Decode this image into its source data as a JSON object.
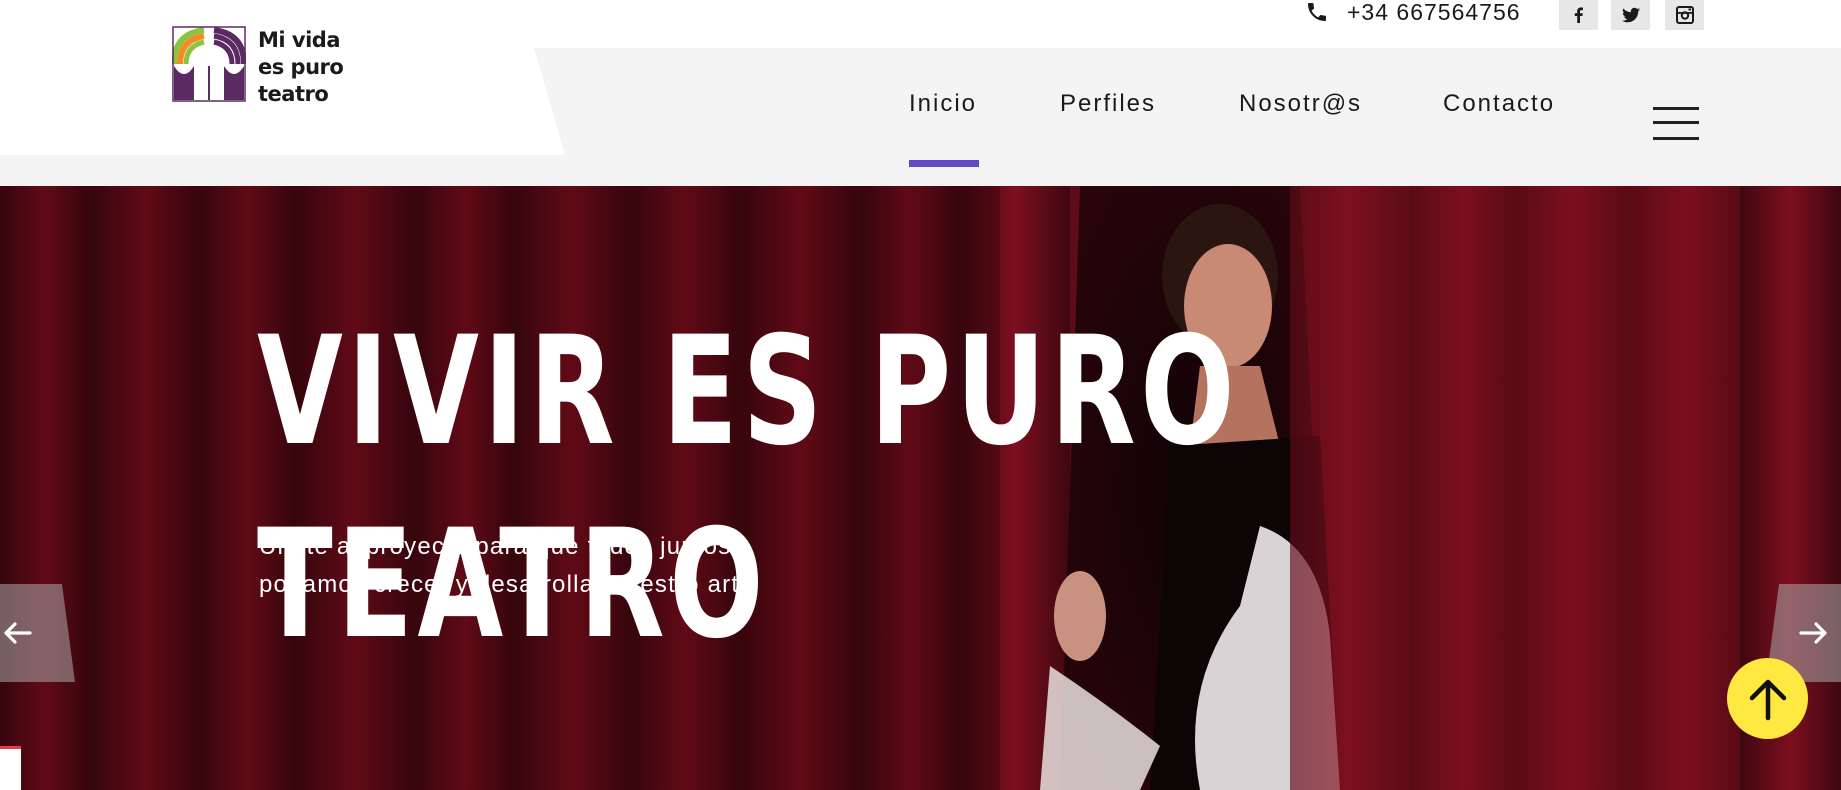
{
  "brand": {
    "logo_lines": [
      "Mi vida",
      "es puro",
      "teatro"
    ],
    "colors": {
      "purple": "#5c2a63",
      "green": "#8bc53f",
      "orange": "#f28c28"
    }
  },
  "topbar": {
    "phone_icon": "phone-icon",
    "phone": "+34 667564756",
    "social": [
      {
        "name": "facebook-icon"
      },
      {
        "name": "twitter-icon"
      },
      {
        "name": "instagram-icon"
      }
    ]
  },
  "nav": {
    "items": [
      "Inicio",
      "Perfiles",
      "Nosotr@s",
      "Contacto"
    ],
    "active": "Inicio",
    "active_color": "#6547c7",
    "menu_icon": "hamburger-menu-icon"
  },
  "hero": {
    "title_lines": [
      "VIVIR ES PURO",
      "TEATRO"
    ],
    "subtitle_lines": [
      "Únete al proyecto para que todos juntos",
      "podamos crecer y desarrollar nuestro arte"
    ],
    "prev_icon": "arrow-left-icon",
    "next_icon": "arrow-right-icon",
    "background_color": "#6a0e1c"
  },
  "scroll_top": {
    "icon": "arrow-up-icon",
    "color": "#ffe83f"
  }
}
